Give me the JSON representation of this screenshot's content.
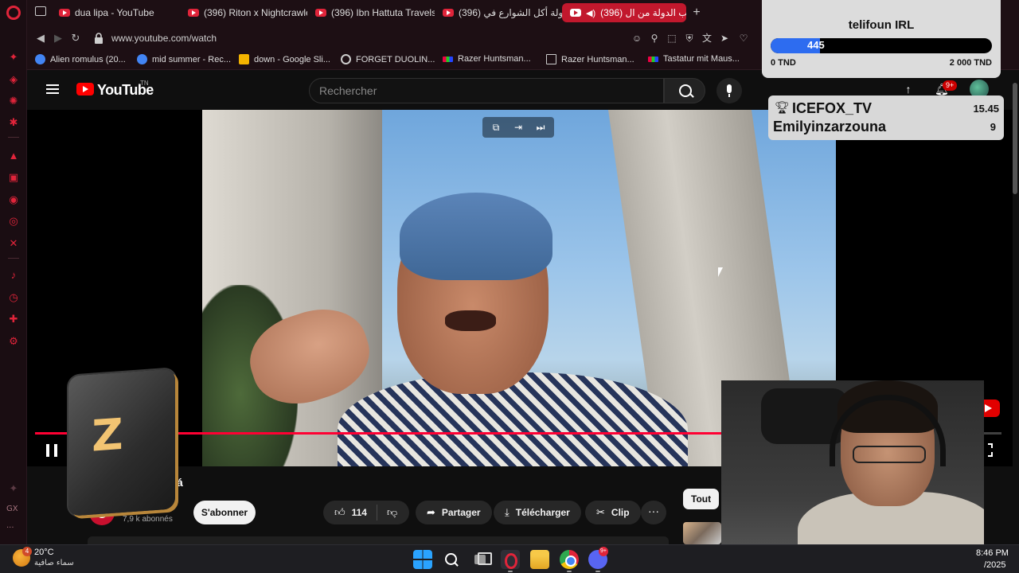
{
  "browser": {
    "tabs": [
      {
        "title": "dua lipa - YouTube"
      },
      {
        "title": "(396) Riton x Nightcrawle"
      },
      {
        "title": "(396) Ibn Hattuta Travels"
      },
      {
        "title": "(396) جولة أكل الشوارع في"
      },
      {
        "title": "(396) ظرب الدولة من ال",
        "active": true
      }
    ],
    "url": "www.youtube.com/watch",
    "bookmarks": [
      {
        "label": "Alien romulus (20..."
      },
      {
        "label": "mid summer - Rec..."
      },
      {
        "label": "down - Google Sli..."
      },
      {
        "label": "FORGET DUOLIN..."
      },
      {
        "label": "Razer Huntsman..."
      },
      {
        "label": "Razer Huntsman..."
      },
      {
        "label": "Tastatur mit Maus..."
      }
    ],
    "sidebar_text": "GX"
  },
  "youtube": {
    "logo_text": "YouTube",
    "country_code": "TN",
    "search_placeholder": "Rechercher",
    "notifications_badge": "9+",
    "title_fragment": "á",
    "channel_name_fragment": "T",
    "subscribers": "7,9 k abonnés",
    "subscribe_label": "S'abonner",
    "likes": "114",
    "share_label": "Partager",
    "download_label": "Télécharger",
    "clip_label": "Clip",
    "more_label": "···",
    "chip_all": "Tout",
    "progress_fraction": 0.745
  },
  "brand_overlay": {
    "mark": "Z"
  },
  "donation_goal": {
    "title": "telifoun IRL",
    "current": "445",
    "min_label": "0 TND",
    "max_label": "2 000 TND",
    "fraction": 0.2225
  },
  "leaderboard": {
    "first_name": "ICEFOX_TV",
    "first_value": "15.45",
    "second_name": "Emilyinzarzouna",
    "second_value": "9"
  },
  "taskbar": {
    "weather_badge": "4",
    "temperature": "20°C",
    "weather_desc": "سماء صافية",
    "discord_badge": "9+",
    "time_fragment": "8:46 PM",
    "date_fragment": "/2025"
  }
}
